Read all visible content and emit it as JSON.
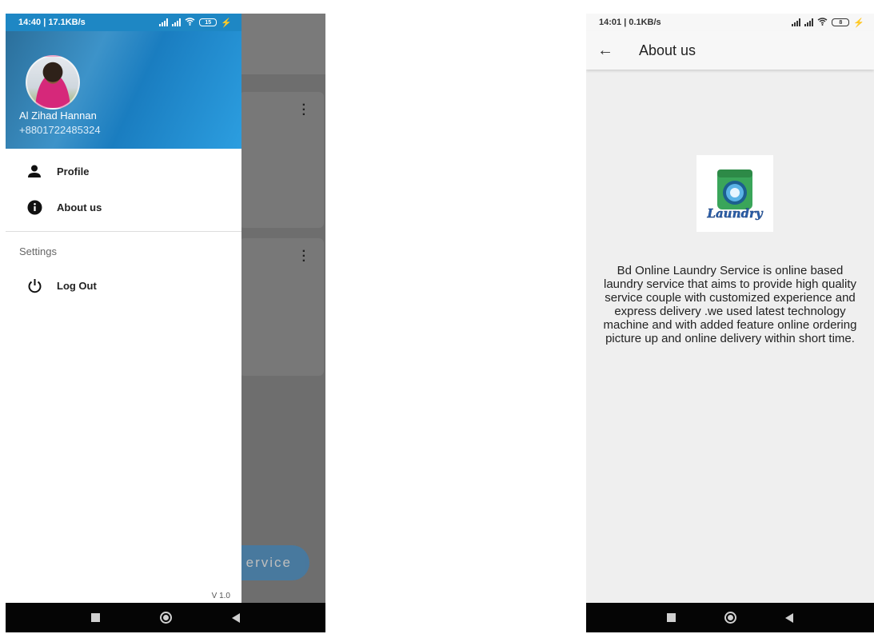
{
  "left_screen": {
    "status": {
      "time": "14:40 | 17.1KB/s",
      "battery": "15"
    },
    "drawer": {
      "user_name": "Al Zihad Hannan",
      "user_phone": "+8801722485324",
      "menu": [
        {
          "label": "Profile",
          "icon": "person-icon"
        },
        {
          "label": "About us",
          "icon": "info-icon"
        }
      ],
      "settings_label": "Settings",
      "logout_label": "Log Out",
      "version": "V 1.0"
    },
    "background": {
      "fab_label": "ervice"
    }
  },
  "right_screen": {
    "status": {
      "time": "14:01 | 0.1KB/s",
      "battery": "8"
    },
    "appbar_title": "About us",
    "logo_text": "Laundry",
    "about_text": "Bd Online Laundry Service is online based laundry service that aims to provide high quality service couple with customized experience and express delivery .we used latest technology machine and with added feature online ordering picture up and online delivery within short time."
  },
  "colors": {
    "drawer_header": "#1a7dc0",
    "fab": "#2a82c6",
    "scrim": "#6e6e6e"
  }
}
